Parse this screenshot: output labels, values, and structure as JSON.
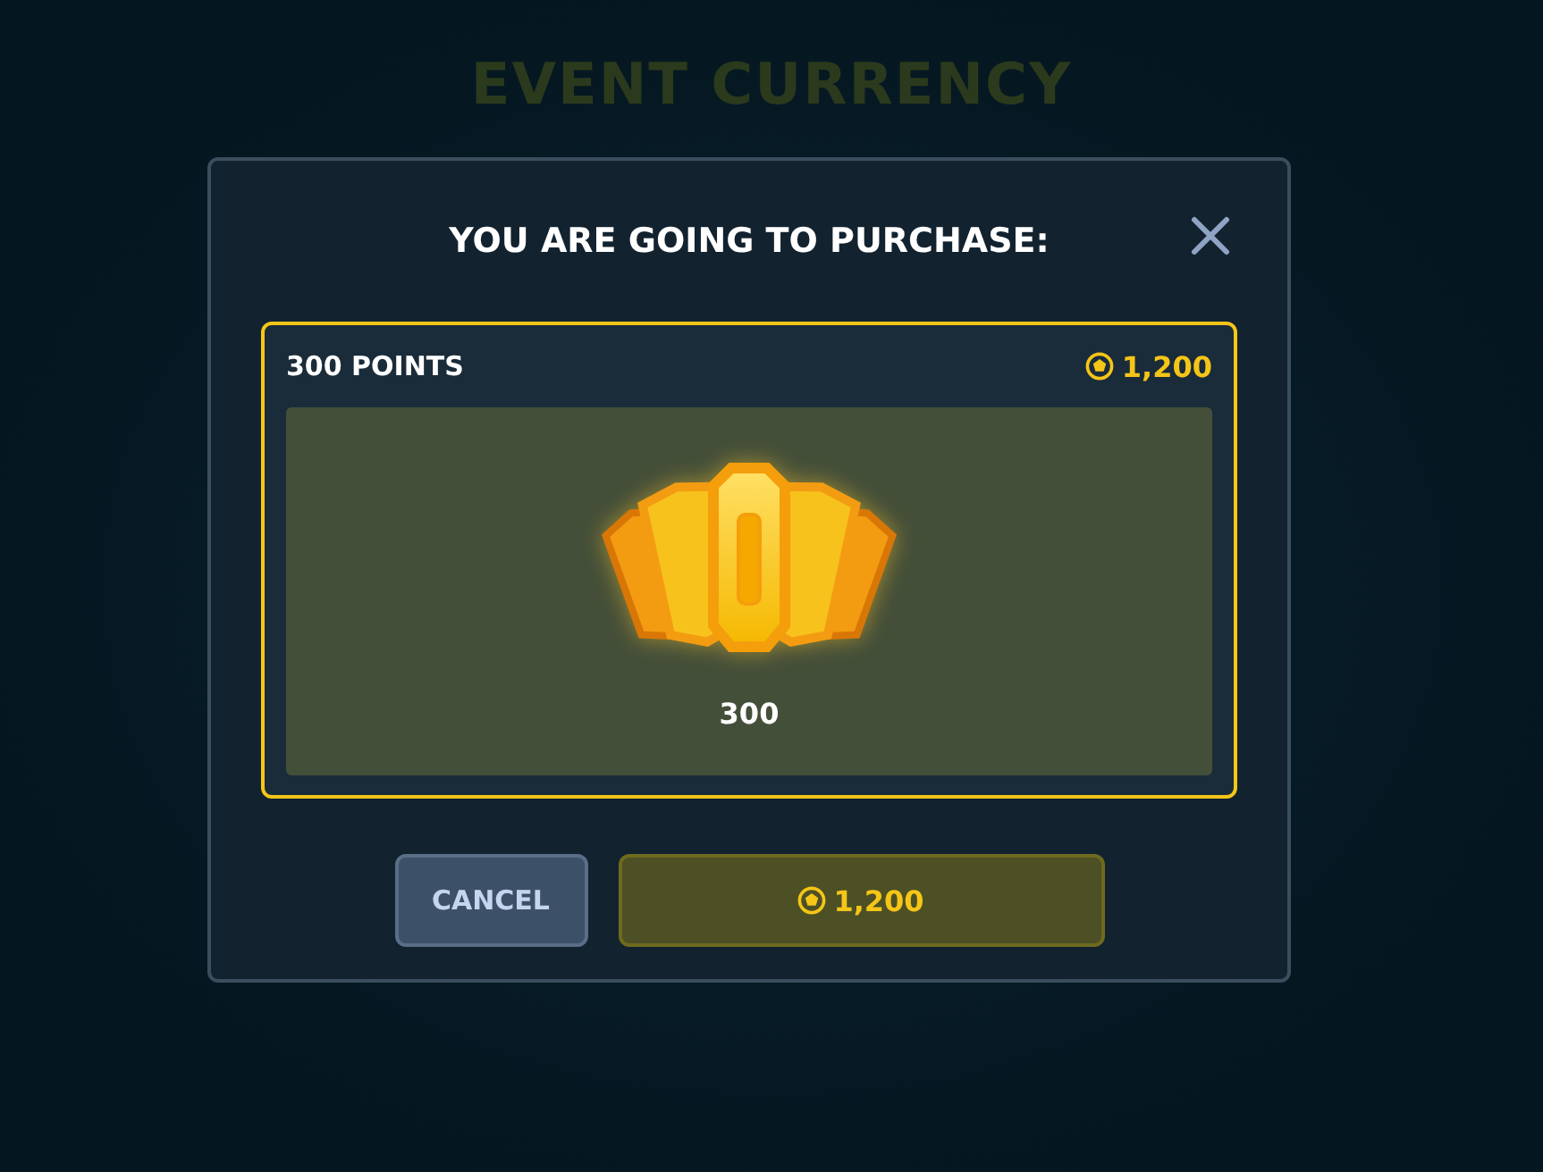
{
  "background": {
    "title": "EVENT CURRENCY"
  },
  "dialog": {
    "title": "YOU ARE GOING TO PURCHASE:",
    "item": {
      "name": "300 POINTS",
      "price": "1,200",
      "amount": "300"
    },
    "buttons": [
      {
        "kind": "cancel",
        "label": "CANCEL"
      },
      {
        "kind": "buy",
        "label": "1,200"
      }
    ]
  }
}
